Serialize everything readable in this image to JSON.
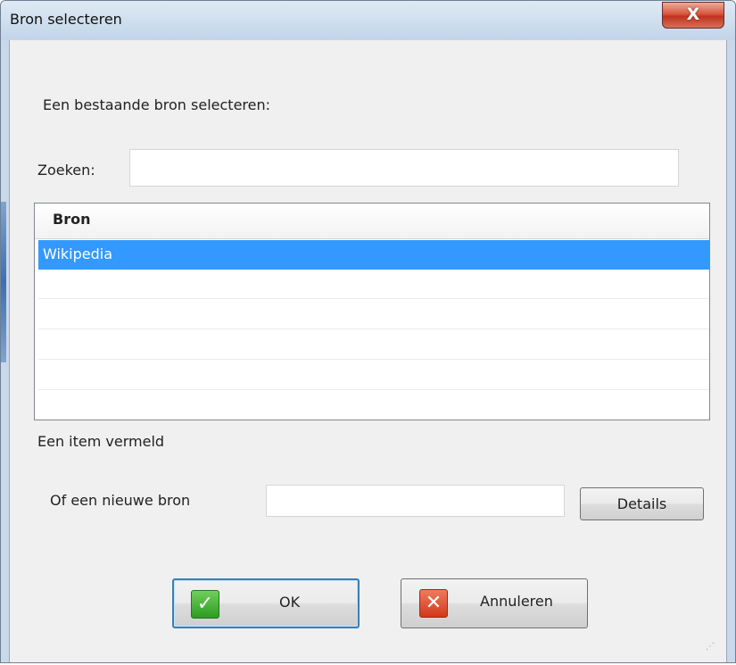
{
  "window": {
    "title": "Bron selecteren",
    "close_symbol": "X"
  },
  "form": {
    "select_existing_label": "Een bestaande bron selecteren:",
    "search_label": "Zoeken:",
    "search_value": "",
    "list_header": "Bron",
    "list_items": [
      "Wikipedia",
      "",
      "",
      "",
      ""
    ],
    "selected_index": 0,
    "item_count_text": "Een item vermeld",
    "new_source_label": "Of een nieuwe bron",
    "new_source_value": "",
    "details_button": "Details"
  },
  "buttons": {
    "ok_label": "OK",
    "cancel_label": "Annuleren",
    "ok_icon": "checkmark-icon",
    "cancel_icon": "cross-icon"
  },
  "colors": {
    "selection": "#3399ff",
    "close_button": "#c0321d",
    "ok_icon": "#2e9b22",
    "cancel_icon": "#d2391a"
  }
}
